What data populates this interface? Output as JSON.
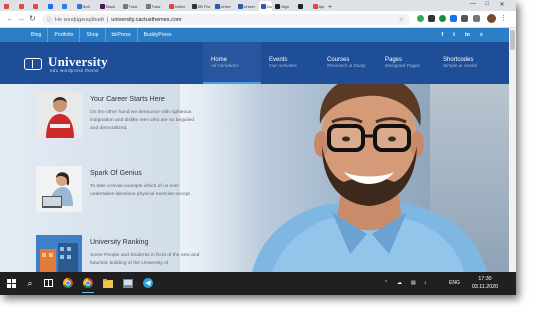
{
  "browser": {
    "tabs": [
      {
        "label": "",
        "color": "#e04a3a"
      },
      {
        "label": "",
        "color": "#e04a3a"
      },
      {
        "label": "",
        "color": "#e04a3a"
      },
      {
        "label": "",
        "color": "#1a73e8"
      },
      {
        "label": "",
        "color": "#2b7be0"
      },
      {
        "label": "Noti",
        "color": "#3a6fd6"
      },
      {
        "label": "Slack",
        "color": "#4a154b"
      },
      {
        "label": "Tutor",
        "color": "#777777"
      },
      {
        "label": "Tutor",
        "color": "#777777"
      },
      {
        "label": "InWor",
        "color": "#e04a3a"
      },
      {
        "label": "SB Pro",
        "color": "#333333"
      },
      {
        "label": "Unive",
        "color": "#2a5aa8"
      },
      {
        "label": "Univer",
        "color": "#2a5aa8"
      },
      {
        "label": "Ca",
        "color": "#2a5aa8",
        "active": true
      },
      {
        "label": "Sign",
        "color": "#222222"
      },
      {
        "label": "",
        "color": "#222222"
      },
      {
        "label": "Api",
        "color": "#e04a3a"
      }
    ],
    "new_tab": "+",
    "window_controls": [
      "—",
      "□",
      "✕"
    ],
    "back_icon": "←",
    "forward_icon": "→",
    "reload_icon": "↻",
    "not_secure": "Не конфіденційний",
    "url": "university.cactusthemes.com",
    "extension_colors": [
      "#34a853",
      "#333333",
      "#1e8e3e",
      "#1a73e8",
      "#555555",
      "#555555",
      "#555555"
    ]
  },
  "site": {
    "top_nav": [
      "Blog",
      "Portfolio",
      "Shop",
      "bbPress",
      "BuddyPress"
    ],
    "social_icons": [
      "f",
      "t",
      "in",
      "search-icon"
    ],
    "social_glyphs": [
      "f",
      "t",
      "in",
      "⌕"
    ],
    "logo": {
      "title": "University",
      "tagline": "edu wordpress theme"
    },
    "main_nav": [
      {
        "title": "Home",
        "subtitle": "All Variations",
        "active": true
      },
      {
        "title": "Events",
        "subtitle": "Our Activities"
      },
      {
        "title": "Courses",
        "subtitle": "Research & Study"
      },
      {
        "title": "Pages",
        "subtitle": "Designed Pages"
      },
      {
        "title": "Shortcodes",
        "subtitle": "Simple & Useful"
      }
    ],
    "features": [
      {
        "title": "Your Career Starts Here",
        "description": "On the other hand we denounce with righteous indignation and dislike men who are so beguiled and demoralized."
      },
      {
        "title": "Spark Of Genius",
        "description": "To take a trivial example which of us ever undertakes laborious physical exercise except."
      },
      {
        "title": "University Ranking",
        "description": "Some People and Students in front of the new and futuristic building of the University of"
      }
    ]
  },
  "taskbar": {
    "icons": [
      "windows-icon",
      "search-icon",
      "task-view-icon",
      "chrome-icon",
      "chrome-icon",
      "files-icon",
      "explorer-icon",
      "photos-icon",
      "telegram-icon"
    ],
    "tray_icons": [
      "chevron-up-icon",
      "cloud-icon",
      "volume-icon",
      "network-icon"
    ],
    "language": "ENG",
    "time": "17:30",
    "date": "03.11.2020"
  },
  "colors": {
    "topbar": "#2a7fc7",
    "header": "#1f4e99",
    "nav_active_accent": "#4aa0e8",
    "taskbar": "#202020"
  }
}
